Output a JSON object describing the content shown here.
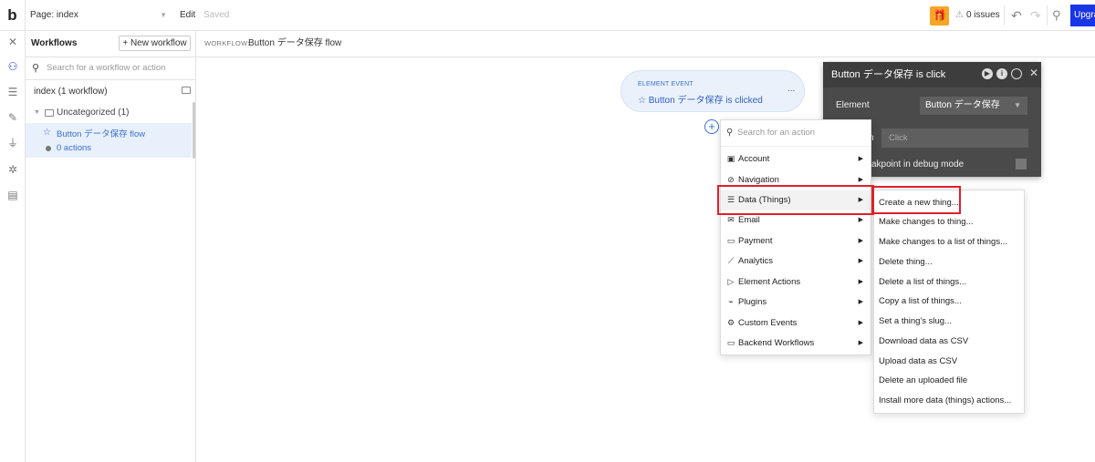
{
  "topbar": {
    "logo": "b",
    "page_label": "Page: index",
    "edit_label": "Edit",
    "saved_label": "Saved",
    "issues_label": "0 issues",
    "upgrade_label": "Upgrade"
  },
  "panel": {
    "title": "Workflows",
    "new_workflow": "+ New workflow",
    "search_placeholder": "Search for a workflow or action",
    "page_row": "index (1 workflow)",
    "category": "Uncategorized (1)",
    "workflow_name": "Button データ保存 flow",
    "workflow_actions": "0 actions"
  },
  "breadcrumb": {
    "prefix": "WORKFLOW:",
    "name": "Button データ保存 flow"
  },
  "event": {
    "tag": "ELEMENT EVENT",
    "title": "Button データ保存 is clicked",
    "more": "..."
  },
  "properties": {
    "title": "Button データ保存 is clicke",
    "element_label": "Element",
    "element_value": "Button データ保存",
    "partial_label": "n",
    "input_placeholder": "Click",
    "debug_label": "akpoint in debug mode"
  },
  "action_menu": {
    "search_placeholder": "Search for an action",
    "items": [
      {
        "label": "Account",
        "icon": "account-icon"
      },
      {
        "label": "Navigation",
        "icon": "navigation-icon"
      },
      {
        "label": "Data (Things)",
        "icon": "database-icon"
      },
      {
        "label": "Email",
        "icon": "email-icon"
      },
      {
        "label": "Payment",
        "icon": "payment-icon"
      },
      {
        "label": "Analytics",
        "icon": "analytics-icon"
      },
      {
        "label": "Element Actions",
        "icon": "element-actions-icon"
      },
      {
        "label": "Plugins",
        "icon": "plugin-icon"
      },
      {
        "label": "Custom Events",
        "icon": "gear-icon"
      },
      {
        "label": "Backend Workflows",
        "icon": "backend-icon"
      }
    ]
  },
  "data_submenu": {
    "items": [
      "Create a new thing...",
      "Make changes to thing...",
      "Make changes to a list of things...",
      "Delete thing...",
      "Delete a list of things...",
      "Copy a list of things...",
      "Set a thing's slug...",
      "Download data as CSV",
      "Upload data as CSV",
      "Delete an uploaded file",
      "Install more data (things) actions..."
    ]
  },
  "colors": {
    "accent": "#1a35e8",
    "highlight": "#e0202a",
    "link": "#3b6fd4",
    "gift": "#f5a623"
  }
}
